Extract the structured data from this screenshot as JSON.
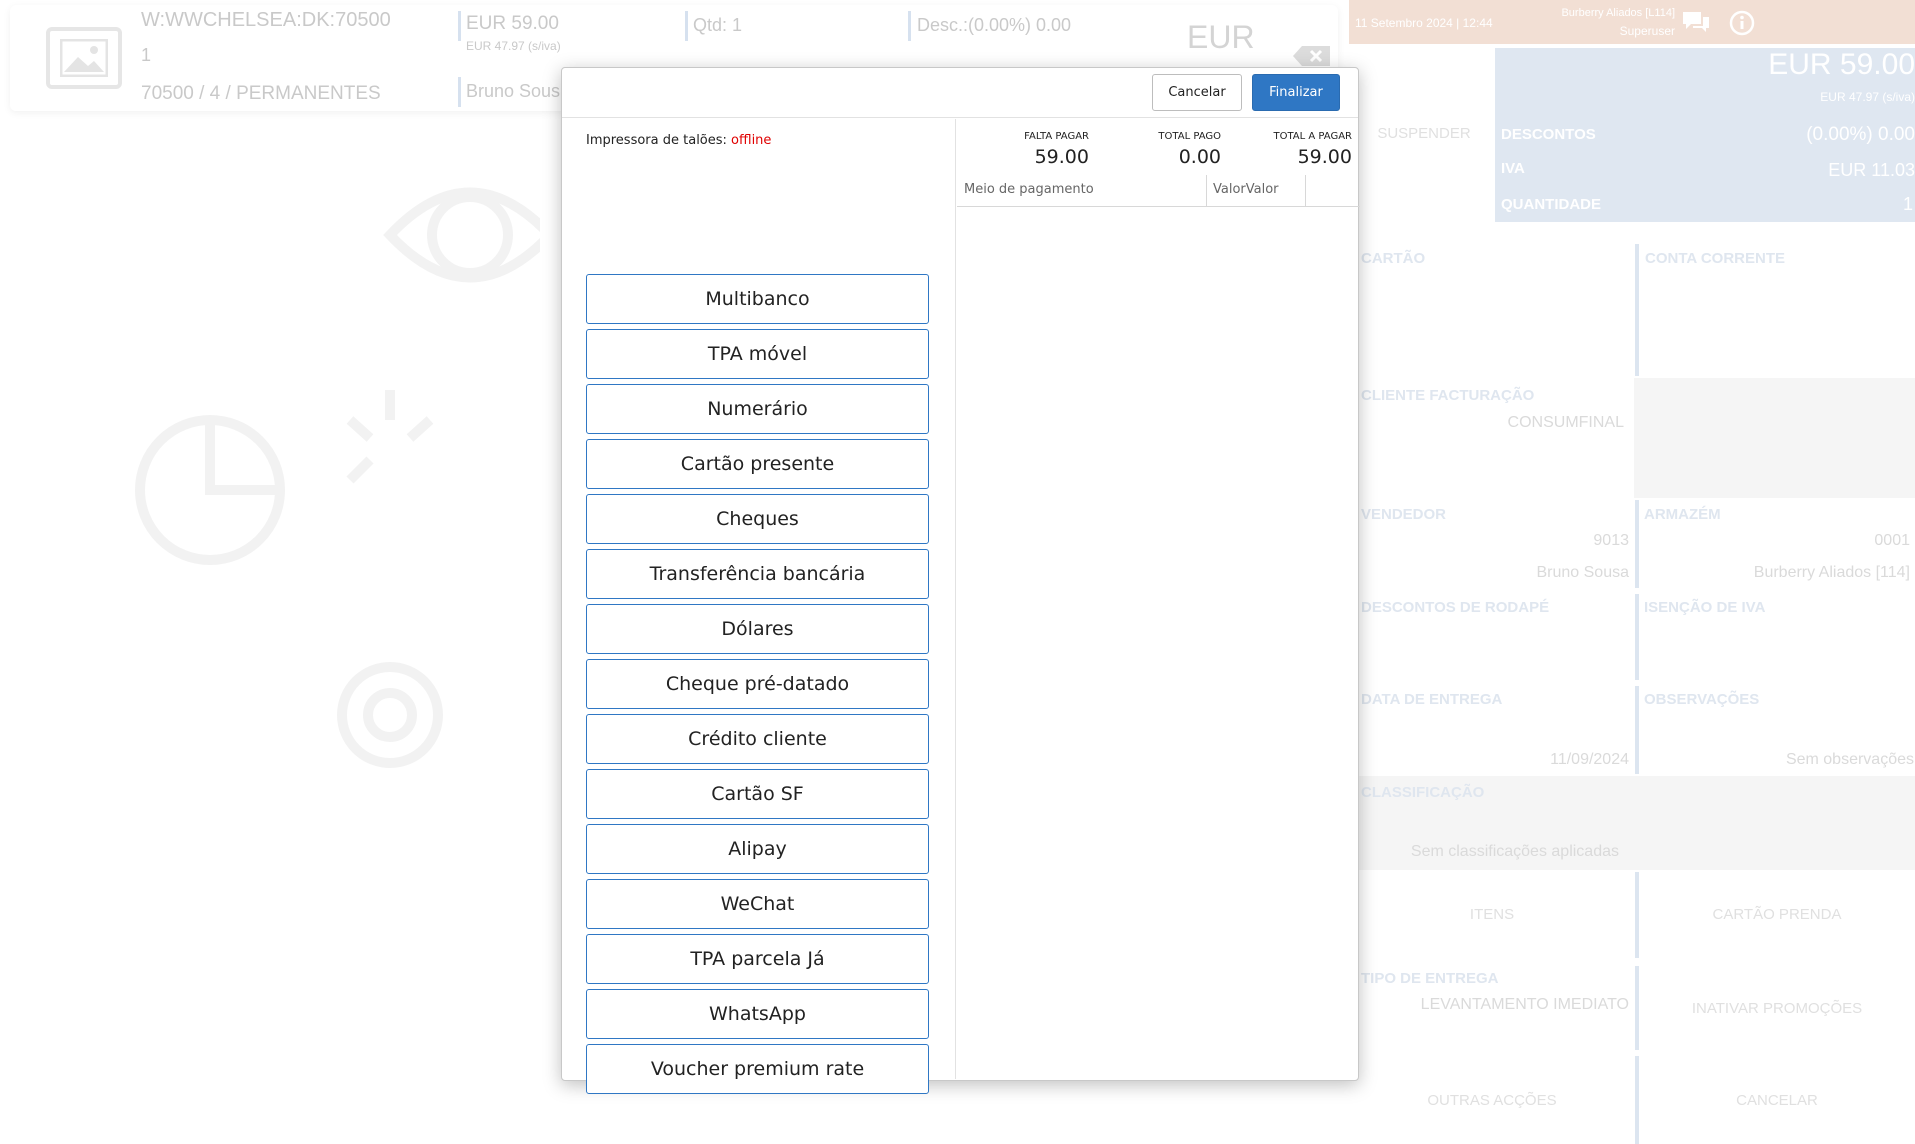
{
  "background": {
    "item": {
      "code": "W:WWCHELSEA:DK:70500",
      "line2": "1",
      "line3": "70500 / 4 / PERMANENTES",
      "price": "EUR 59.00",
      "price_no_vat": "EUR 47.97 (s/iva)",
      "seller": "Bruno Sous",
      "qty": "Qtd: 1",
      "discount": "Desc.:(0.00%) 0.00",
      "currency": "EUR"
    },
    "topbar": {
      "datetime": "11 Setembro 2024 | 12:44",
      "store": "Burberry Aliados [L114]",
      "user": "Superuser"
    },
    "totals": {
      "total": "EUR 59.00",
      "total_no_vat": "EUR 47.97 (s/iva)",
      "discount_label": "DESCONTOS",
      "discount_value": "(0.00%) 0.00",
      "vat_label": "IVA",
      "vat_value": "EUR 11.03",
      "qty_label": "QUANTIDADE",
      "qty_value": "1",
      "suspend": "SUSPENDER"
    },
    "fields": {
      "card": "CARTÃO",
      "current_account": "CONTA CORRENTE",
      "billing_client": "CLIENTE FACTURAÇÃO",
      "billing_client_value": "CONSUMFINAL",
      "seller": "VENDEDOR",
      "seller_code": "9013",
      "seller_name": "Bruno Sousa",
      "warehouse": "ARMAZÉM",
      "warehouse_code": "0001",
      "warehouse_name": "Burberry Aliados [114]",
      "footer_discounts": "DESCONTOS DE RODAPÉ",
      "vat_exemption": "ISENÇÃO DE IVA",
      "delivery_date": "DATA DE ENTREGA",
      "delivery_date_value": "11/09/2024",
      "notes": "OBSERVAÇÕES",
      "notes_value": "Sem observações",
      "classification": "CLASSIFICAÇÃO",
      "classification_value": "Sem classificações aplicadas",
      "items": "ITENS",
      "gift_card": "CARTÃO PRENDA",
      "delivery_type": "TIPO DE ENTREGA",
      "delivery_type_value": "LEVANTAMENTO IMEDIATO",
      "deactivate_promos": "INATIVAR PROMOÇÕES",
      "other_actions": "OUTRAS ACÇÕES",
      "cancel": "CANCELAR"
    }
  },
  "modal": {
    "cancel_label": "Cancelar",
    "finish_label": "Finalizar",
    "printer_label": "Impressora de talões: ",
    "printer_status": "offline",
    "payment_methods": [
      "Multibanco",
      "TPA móvel",
      "Numerário",
      "Cartão presente",
      "Cheques",
      "Transferência bancária",
      "Dólares",
      "Cheque pré-datado",
      "Crédito cliente",
      "Cartão SF",
      "Alipay",
      "WeChat",
      "TPA parcela Já",
      "WhatsApp",
      "Voucher premium rate"
    ],
    "summary": {
      "remaining_label": "FALTA PAGAR",
      "remaining_value": "59.00",
      "paid_label": "TOTAL PAGO",
      "paid_value": "0.00",
      "to_pay_label": "TOTAL A PAGAR",
      "to_pay_value": "59.00"
    },
    "table": {
      "col_method": "Meio de pagamento",
      "col_value": "ValorValor"
    }
  },
  "colors": {
    "accent": "#2f77c4",
    "offline": "#e00000",
    "topbar_bg": "#f2dfd4",
    "totals_bg": "#dfe7f1"
  }
}
